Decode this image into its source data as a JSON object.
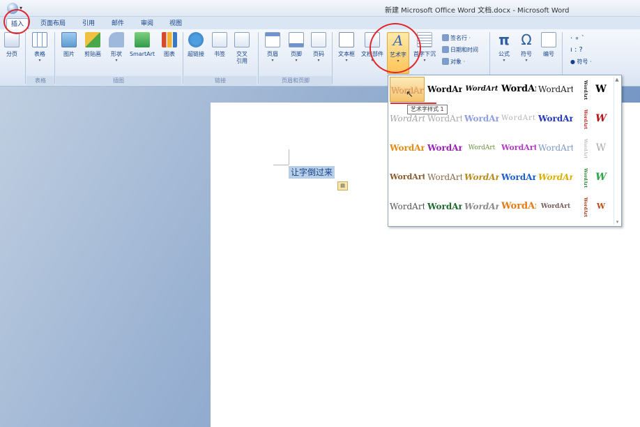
{
  "window": {
    "title": "新建 Microsoft Office Word 文档.docx - Microsoft Word"
  },
  "tabs": [
    {
      "label": "插入",
      "active": true
    },
    {
      "label": "页面布局"
    },
    {
      "label": "引用"
    },
    {
      "label": "邮件"
    },
    {
      "label": "审阅"
    },
    {
      "label": "视图"
    }
  ],
  "ribbon": {
    "pages": {
      "label": "分页"
    },
    "table": {
      "label": "表格",
      "group": "表格"
    },
    "illustrations": {
      "group": "插图",
      "picture": "图片",
      "clipart": "剪贴画",
      "shapes": "形状",
      "smartart": "SmartArt",
      "chart": "图表"
    },
    "links": {
      "group": "链接",
      "hyperlink": "超链接",
      "bookmark": "书签",
      "crossref_line1": "交叉",
      "crossref_line2": "引用"
    },
    "header_footer": {
      "group": "页眉和页脚",
      "header": "页眉",
      "footer": "页脚",
      "page_number": "页码"
    },
    "text": {
      "textbox": "文本框",
      "quickparts": "文档部件",
      "wordart": "艺术字",
      "dropcap": "首字下沉",
      "signature_line": "签名行 ·",
      "datetime": "日期和时间",
      "object": "对象 ·"
    },
    "symbols": {
      "equation": "公式",
      "symbol": "符号",
      "numbering": "编号",
      "special_symbol": "符号 ·"
    },
    "misc_top": "·  ∘  ˋ",
    "misc_mid": "ı  :  ?"
  },
  "document": {
    "selected_text": "让字倒过来",
    "paste_options_icon": "clipboard-icon"
  },
  "wordart_gallery": {
    "tooltip": "艺术字样式 1",
    "rows": [
      [
        "WordArt",
        "WordArt",
        "WordArt",
        "WordArt",
        "WordArt"
      ],
      [
        "WordArt",
        "WordArt",
        "WordArt",
        "WordArt",
        "WordArt"
      ],
      [
        "WordArt",
        "WordArt",
        "WordArt",
        "WordArt",
        "WordArt"
      ],
      [
        "WordArt",
        "WordArt",
        "WordArt",
        "WordArt",
        "WordArt"
      ],
      [
        "WordArt",
        "WordArt",
        "WordArt",
        "WordArt",
        "WordArt"
      ]
    ],
    "vertical_label": "WordArt",
    "side_label": "W"
  },
  "colors": {
    "accent": "#15428b",
    "highlight": "#ffc457",
    "annotation": "#e0262b"
  }
}
